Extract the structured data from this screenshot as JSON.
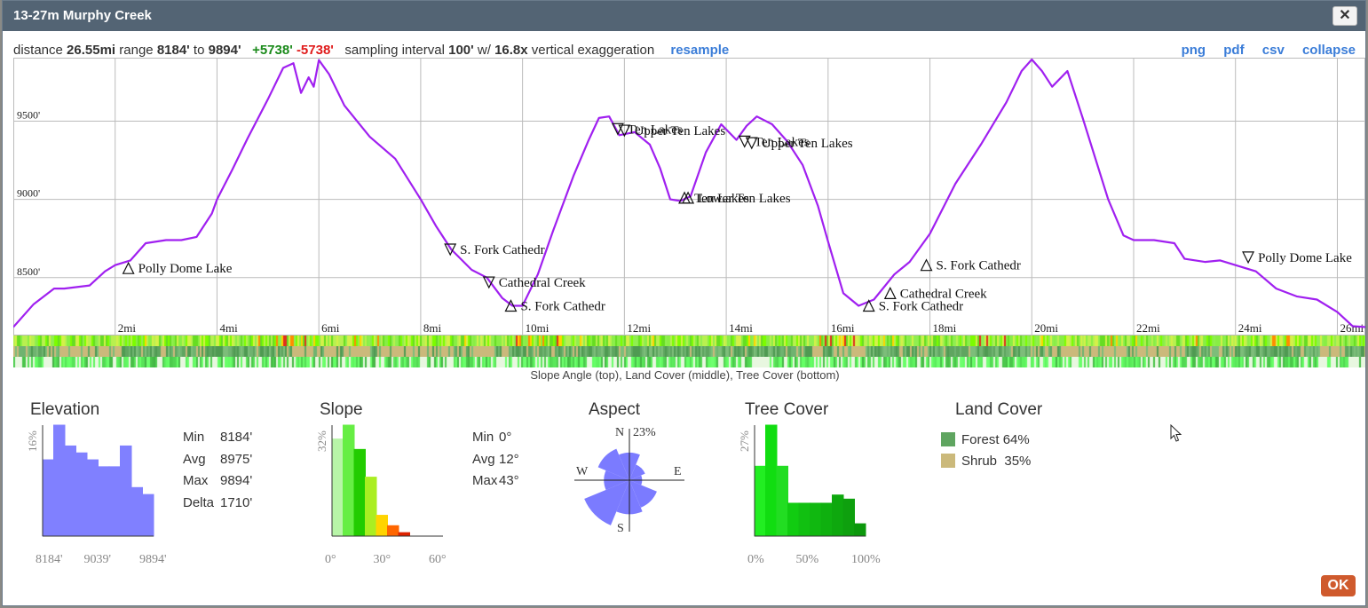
{
  "window": {
    "title": "13-27m Murphy Creek",
    "close_label": "✕"
  },
  "summary": {
    "distance_label": "distance",
    "distance": "26.55mi",
    "range_label": "range",
    "range_min": "8184'",
    "range_to": "to",
    "range_max": "9894'",
    "gain": "+5738'",
    "loss": "-5738'",
    "sampling_label": "sampling interval",
    "sampling": "100'",
    "with_label": "w/",
    "exaggeration": "16.8x",
    "exaggeration_label": "vertical exaggeration",
    "resample_label": "resample"
  },
  "actions": {
    "png": "png",
    "pdf": "pdf",
    "csv": "csv",
    "collapse": "collapse"
  },
  "colors": {
    "profile": "#a020f0",
    "slope_hist": "#66ee44",
    "elev_hist": "#8080ff",
    "forest": "#5fa560",
    "shrub": "#cbb97b",
    "ok": "#cf5a2d"
  },
  "chart_data": {
    "type": "line",
    "title": "",
    "xlabel": "",
    "ylabel": "",
    "xlim": [
      0,
      26.55
    ],
    "ylim": [
      8130,
      9894
    ],
    "y_ticks": [
      "8500'",
      "9000'",
      "9500'"
    ],
    "y_tick_values": [
      8500,
      9000,
      9500
    ],
    "x_ticks": [
      "2mi",
      "4mi",
      "6mi",
      "8mi",
      "10mi",
      "12mi",
      "14mi",
      "16mi",
      "18mi",
      "20mi",
      "22mi",
      "24mi",
      "26mi"
    ],
    "x_tick_values": [
      2,
      4,
      6,
      8,
      10,
      12,
      14,
      16,
      18,
      20,
      22,
      24,
      26
    ],
    "series": [
      {
        "x": [
          0,
          0.4,
          0.8,
          1.0,
          1.5,
          1.8,
          2.0,
          2.3,
          2.6,
          3.0,
          3.3,
          3.6,
          3.9,
          4.0,
          4.3,
          4.6,
          5.0,
          5.3,
          5.5,
          5.65,
          5.8,
          5.9,
          6.0,
          6.2,
          6.5,
          7.0,
          7.5,
          8.0,
          8.3,
          8.6,
          9.0,
          9.3,
          9.6,
          9.8,
          10.0,
          10.3,
          10.6,
          11.0,
          11.3,
          11.5,
          11.7,
          11.9,
          12.2,
          12.5,
          12.7,
          12.9,
          13.1,
          13.3,
          13.6,
          13.9,
          14.2,
          14.4,
          14.6,
          14.9,
          15.2,
          15.5,
          15.8,
          16.0,
          16.3,
          16.6,
          16.9,
          17.3,
          17.6,
          18.0,
          18.5,
          19.0,
          19.5,
          19.8,
          20.0,
          20.2,
          20.4,
          20.7,
          21.0,
          21.5,
          21.8,
          22.0,
          22.4,
          22.8,
          23.0,
          23.4,
          23.7,
          24.0,
          24.4,
          24.8,
          25.2,
          25.6,
          26.0,
          26.3,
          26.55
        ],
        "y": [
          8184,
          8330,
          8430,
          8430,
          8450,
          8540,
          8580,
          8610,
          8720,
          8740,
          8740,
          8760,
          8910,
          9000,
          9190,
          9390,
          9640,
          9840,
          9870,
          9680,
          9780,
          9720,
          9890,
          9800,
          9600,
          9400,
          9260,
          9000,
          8830,
          8680,
          8550,
          8500,
          8370,
          8320,
          8320,
          8520,
          8800,
          9150,
          9380,
          9520,
          9530,
          9410,
          9430,
          9350,
          9200,
          9000,
          8990,
          9020,
          9300,
          9480,
          9380,
          9470,
          9530,
          9480,
          9370,
          9220,
          8960,
          8730,
          8400,
          8320,
          8360,
          8520,
          8600,
          8780,
          9100,
          9350,
          9620,
          9820,
          9894,
          9820,
          9720,
          9820,
          9520,
          9000,
          8770,
          8740,
          8740,
          8720,
          8620,
          8600,
          8610,
          8580,
          8540,
          8430,
          8380,
          8360,
          8280,
          8190,
          8184
        ]
      }
    ],
    "annotations": [
      {
        "label": "Polly Dome Lake",
        "x": 2.26,
        "y": 8560,
        "symbol": "up"
      },
      {
        "label": "S. Fork Cathedr",
        "x": 8.58,
        "y": 8680,
        "symbol": "down"
      },
      {
        "label": "Cathedral Creek",
        "x": 9.34,
        "y": 8470,
        "symbol": "down"
      },
      {
        "label": "S. Fork Cathedr",
        "x": 9.77,
        "y": 8320,
        "symbol": "up"
      },
      {
        "label": "Ten Lakes",
        "x": 11.87,
        "y": 9450,
        "symbol": "down"
      },
      {
        "label": "Upper Ten Lakes",
        "x": 12.0,
        "y": 9440,
        "symbol": "down"
      },
      {
        "label": "Ten Lakes",
        "x": 13.18,
        "y": 9010,
        "symbol": "up"
      },
      {
        "label": "Lower Ten Lakes",
        "x": 13.25,
        "y": 9010,
        "symbol": "up"
      },
      {
        "label": "Ten Lakes",
        "x": 14.36,
        "y": 9370,
        "symbol": "down"
      },
      {
        "label": "Upper Ten Lakes",
        "x": 14.5,
        "y": 9360,
        "symbol": "down"
      },
      {
        "label": "S. Fork Cathedr",
        "x": 16.8,
        "y": 8320,
        "symbol": "up"
      },
      {
        "label": "Cathedral Creek",
        "x": 17.22,
        "y": 8400,
        "symbol": "up"
      },
      {
        "label": "S. Fork Cathedr",
        "x": 17.93,
        "y": 8580,
        "symbol": "up"
      },
      {
        "label": "Polly Dome Lake",
        "x": 24.25,
        "y": 8630,
        "symbol": "down"
      }
    ]
  },
  "strips": {
    "caption": "Slope Angle (top), Land Cover (middle), Tree Cover (bottom)"
  },
  "stats": {
    "elevation": {
      "title": "Elevation",
      "rows": [
        {
          "k": "Min",
          "v": "8184'"
        },
        {
          "k": "Avg",
          "v": "8975'"
        },
        {
          "k": "Max",
          "v": "9894'"
        },
        {
          "k": "Delta",
          "v": "1710'"
        }
      ],
      "ymax_label": "16%",
      "x_labels": [
        "8184'",
        "9039'",
        "9894'"
      ],
      "hist_values": [
        11,
        16,
        13,
        12,
        11,
        10,
        10,
        13,
        7,
        6
      ]
    },
    "slope": {
      "title": "Slope",
      "rows": [
        {
          "k": "Min",
          "v": "0°"
        },
        {
          "k": "Avg",
          "v": "12°"
        },
        {
          "k": "Max",
          "v": "43°"
        }
      ],
      "ymax_label": "32%",
      "x_labels": [
        "0°",
        "30°",
        "60°"
      ],
      "hist_values": [
        28,
        32,
        25,
        17,
        6,
        3,
        1,
        0,
        0,
        0
      ]
    },
    "aspect": {
      "title": "Aspect",
      "n_label": "N",
      "s_label": "S",
      "e_label": "E",
      "w_label": "W",
      "max_label": "23%",
      "petal_values": [
        13,
        8,
        6,
        14,
        16,
        23,
        12,
        16
      ]
    },
    "tree_cover": {
      "title": "Tree Cover",
      "ymax_label": "27%",
      "x_labels": [
        "0%",
        "50%",
        "100%"
      ],
      "hist_values": [
        17,
        27,
        17,
        8,
        8,
        8,
        8,
        10,
        9,
        3
      ]
    },
    "land_cover": {
      "title": "Land Cover",
      "items": [
        {
          "label": "Forest",
          "value": "64%"
        },
        {
          "label": "Shrub",
          "value": "35%"
        }
      ]
    }
  },
  "ok_label": "OK"
}
